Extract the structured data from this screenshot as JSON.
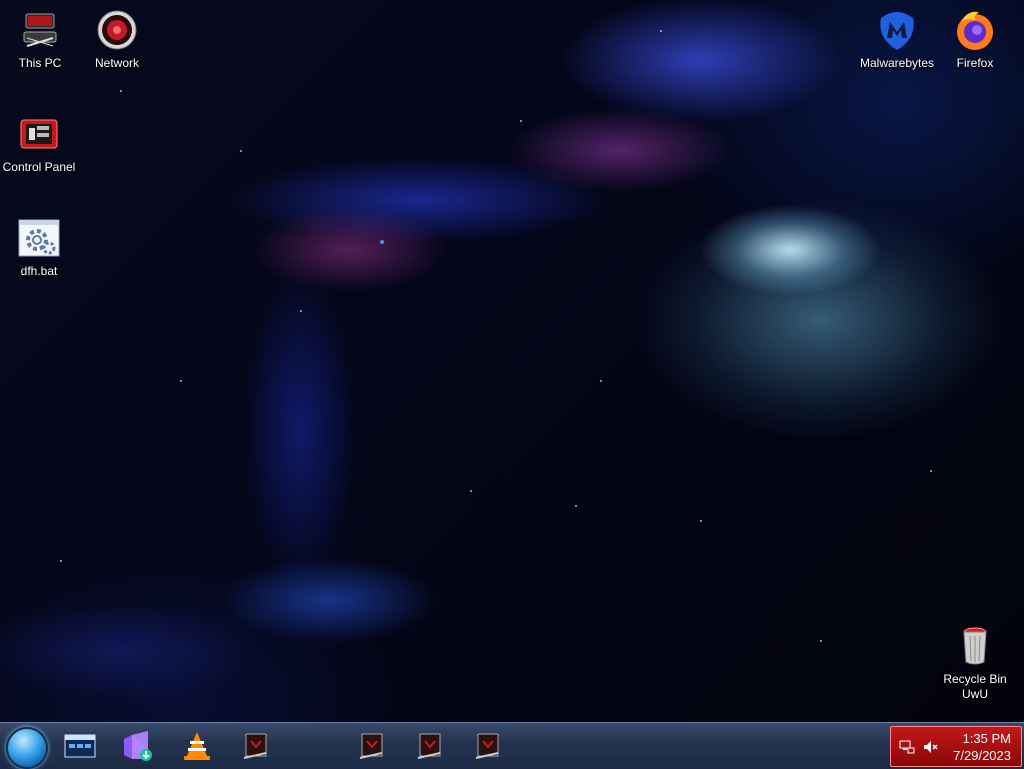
{
  "desktop": {
    "icons": [
      {
        "label": "This PC",
        "icon": "computer-icon"
      },
      {
        "label": "Network",
        "icon": "network-icon"
      },
      {
        "label": "Control Panel",
        "icon": "control-panel-icon"
      },
      {
        "label": "dfh.bat",
        "icon": "batch-file-icon"
      },
      {
        "label": "Malwarebytes",
        "icon": "malwarebytes-icon"
      },
      {
        "label": "Firefox",
        "icon": "firefox-icon"
      },
      {
        "label": "Recycle Bin\nUwU",
        "icon": "recycle-bin-icon"
      }
    ]
  },
  "taskbar": {
    "start": {
      "icon": "start-orb-icon"
    },
    "pinned": [
      {
        "icon": "window-app-icon"
      },
      {
        "icon": "visual-studio-installer-icon"
      },
      {
        "icon": "vlc-icon"
      },
      {
        "icon": "app-window-icon"
      },
      {
        "icon": "app-window-icon"
      },
      {
        "icon": "app-window-icon"
      },
      {
        "icon": "app-window-icon"
      }
    ],
    "tray": {
      "time": "1:35 PM",
      "date": "7/29/2023",
      "network_icon": "network-status-icon",
      "volume_icon": "volume-muted-icon"
    }
  },
  "colors": {
    "tray_bg": "#b81010",
    "taskbar_bg": "#243450",
    "accent_blue": "#3aa3ea"
  }
}
